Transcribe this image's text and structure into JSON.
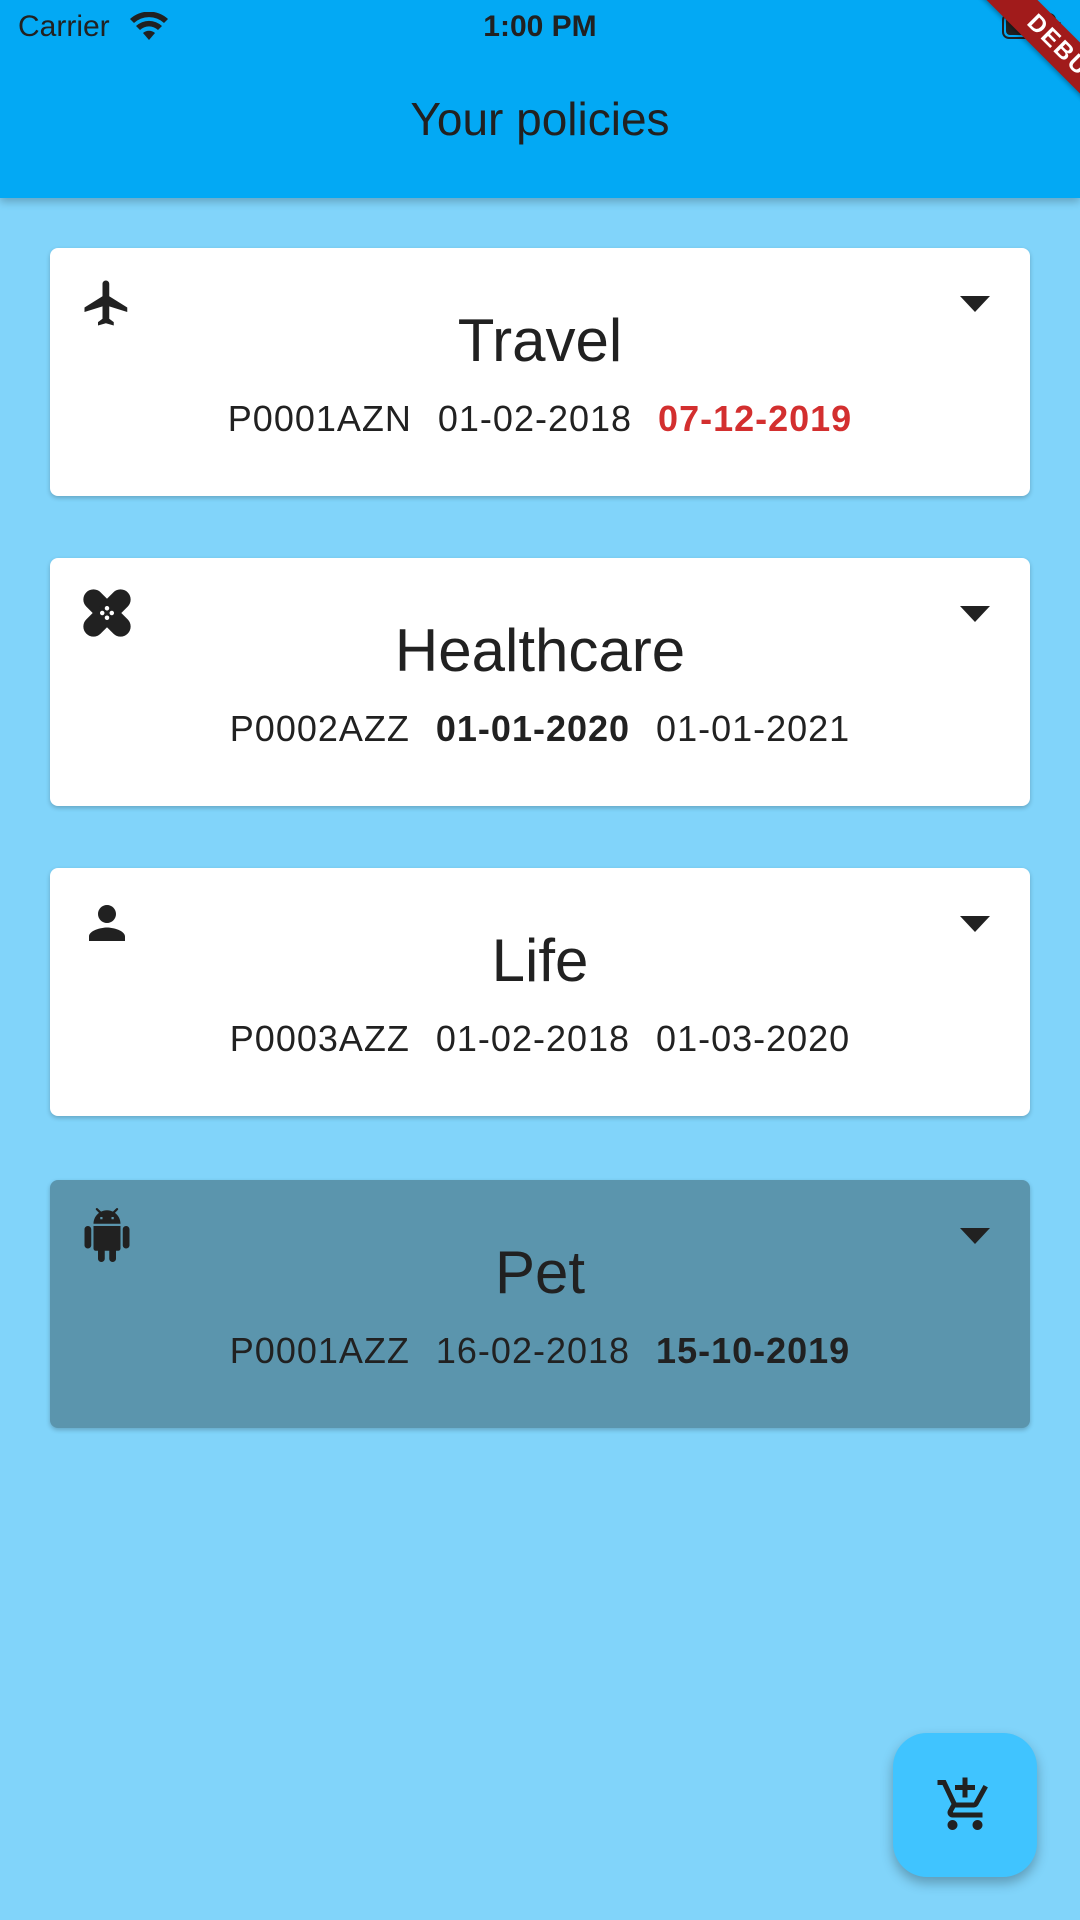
{
  "status_bar": {
    "carrier": "Carrier",
    "time": "1:00 PM"
  },
  "app_bar": {
    "title": "Your policies"
  },
  "debug_banner": "DEBUG",
  "policies": [
    {
      "name": "Travel",
      "icon": "airplane-icon",
      "policy_id": "P0001AZN",
      "start_date": "01-02-2018",
      "end_date": "07-12-2019",
      "highlight": "end-date-red"
    },
    {
      "name": "Healthcare",
      "icon": "bandage-icon",
      "policy_id": "P0002AZZ",
      "start_date": "01-01-2020",
      "end_date": "01-01-2021",
      "highlight": "start-date-bold"
    },
    {
      "name": "Life",
      "icon": "person-icon",
      "policy_id": "P0003AZZ",
      "start_date": "01-02-2018",
      "end_date": "01-03-2020",
      "highlight": "none"
    },
    {
      "name": "Pet",
      "icon": "android-icon",
      "policy_id": "P0001AZZ",
      "start_date": "16-02-2018",
      "end_date": "15-10-2019",
      "highlight": "end-date-bold",
      "selected": true
    }
  ],
  "fab": {
    "icon": "add-shopping-cart-icon"
  },
  "colors": {
    "background": "#81D4FA",
    "app_bar": "#03A9F4",
    "card": "#FFFFFF",
    "selected_card": "#5B95AD",
    "expired_date": "#D32F2F",
    "fab": "#40C4FF",
    "debug_banner": "#A11B1B"
  }
}
